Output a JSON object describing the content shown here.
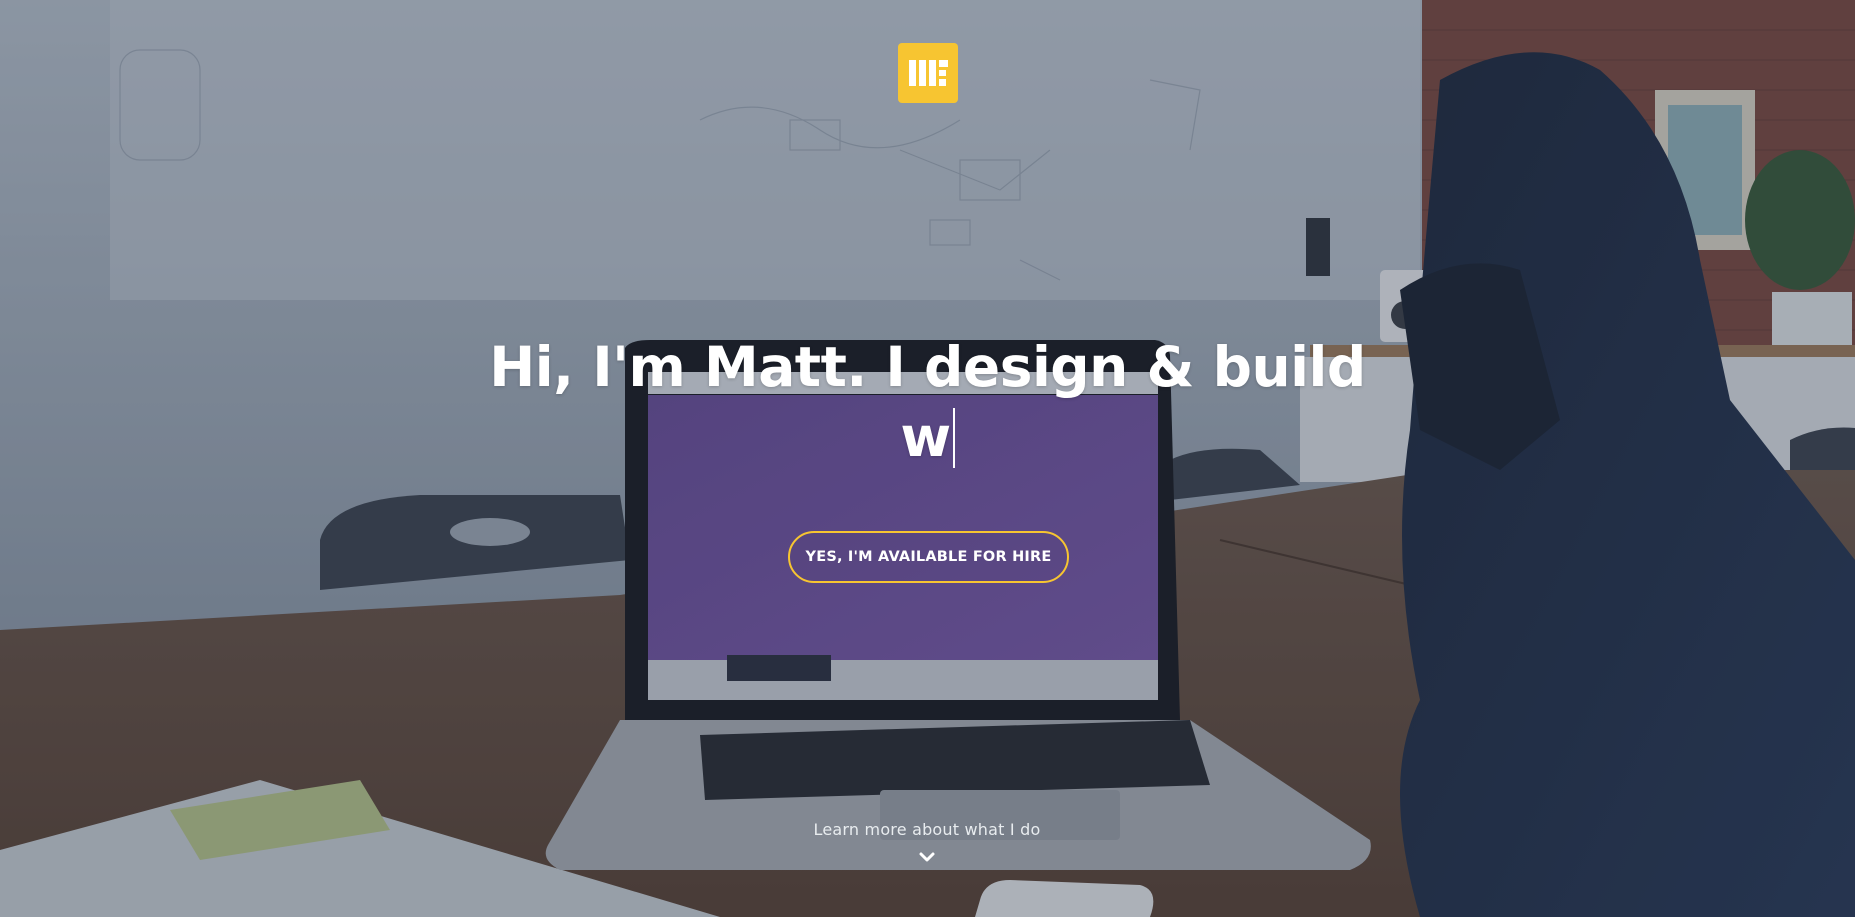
{
  "hero": {
    "headline_static": "Hi, I'm Matt. I design & build",
    "headline_typed": "w",
    "cta_label": "YES, I'M AVAILABLE FOR HIRE",
    "learn_more": "Learn more about what I do",
    "logo_icon": "mf-monogram-icon",
    "scroll_icon": "chevron-down-icon"
  },
  "colors": {
    "accent": "#f7c531",
    "text": "#ffffff"
  }
}
